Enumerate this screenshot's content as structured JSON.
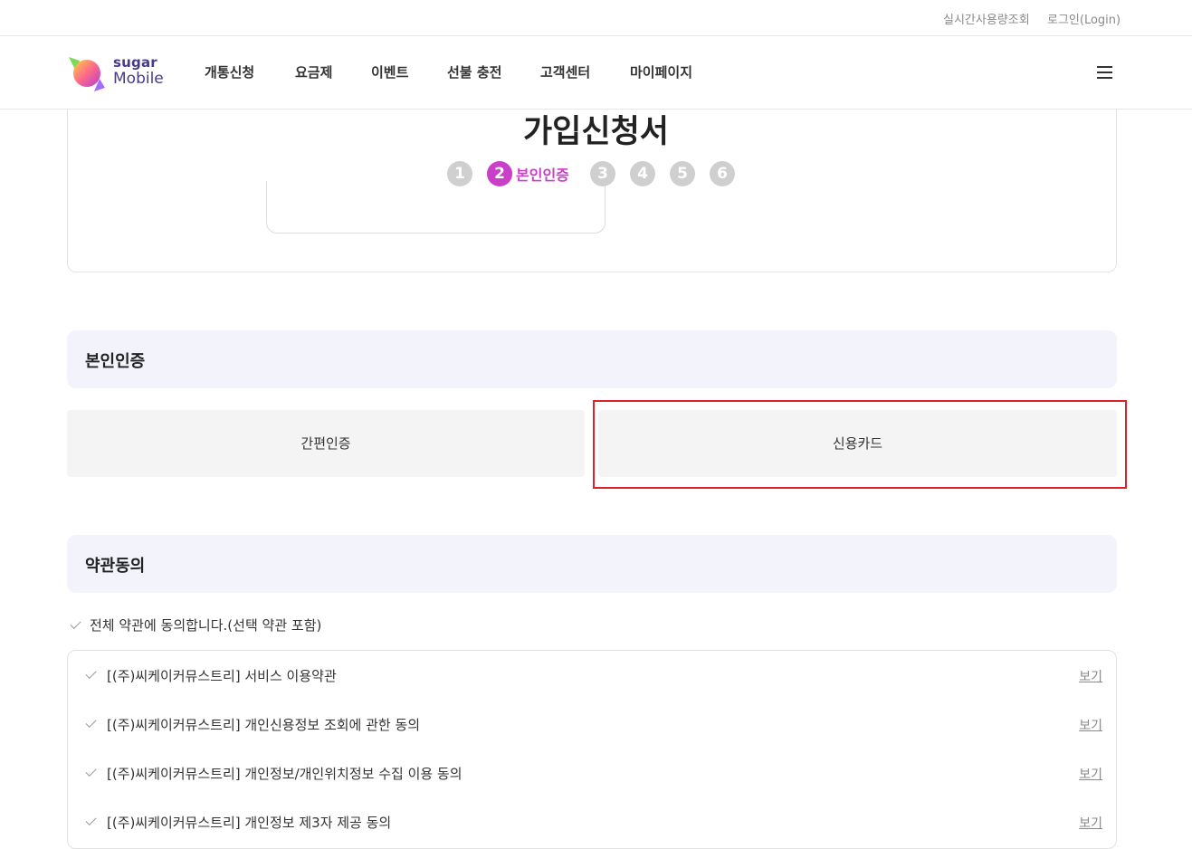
{
  "util_links": {
    "realtime_usage": "실시간사용량조회",
    "login": "로그인(Login)"
  },
  "logo": {
    "line1": "sugar",
    "line2": "Mobile"
  },
  "nav": [
    "개통신청",
    "요금제",
    "이벤트",
    "선불 충전",
    "고객센터",
    "마이페이지"
  ],
  "page_title": "가입신청서",
  "stepper": {
    "steps": [
      "1",
      "2",
      "3",
      "4",
      "5",
      "6"
    ],
    "active_step": "2",
    "active_label": "본인인증",
    "active_color": "#c93fc7"
  },
  "identity_section": {
    "title": "본인인증",
    "options": [
      "간편인증",
      "신용카드"
    ],
    "highlighted_option": "신용카드"
  },
  "terms_section": {
    "title": "약관동의",
    "agree_all": "전체 약관에 동의합니다.(선택 약관 포함)",
    "view_label": "보기",
    "items": [
      "[(주)씨케이커뮤스트리] 서비스 이용약관",
      "[(주)씨케이커뮤스트리] 개인신용정보 조회에 관한 동의",
      "[(주)씨케이커뮤스트리] 개인정보/개인위치정보 수집 이용 동의",
      "[(주)씨케이커뮤스트리] 개인정보 제3자 제공 동의"
    ]
  },
  "colors": {
    "accent": "#c93fc7",
    "section_bg": "#f2f3fb",
    "highlight_border": "#d9222a"
  }
}
